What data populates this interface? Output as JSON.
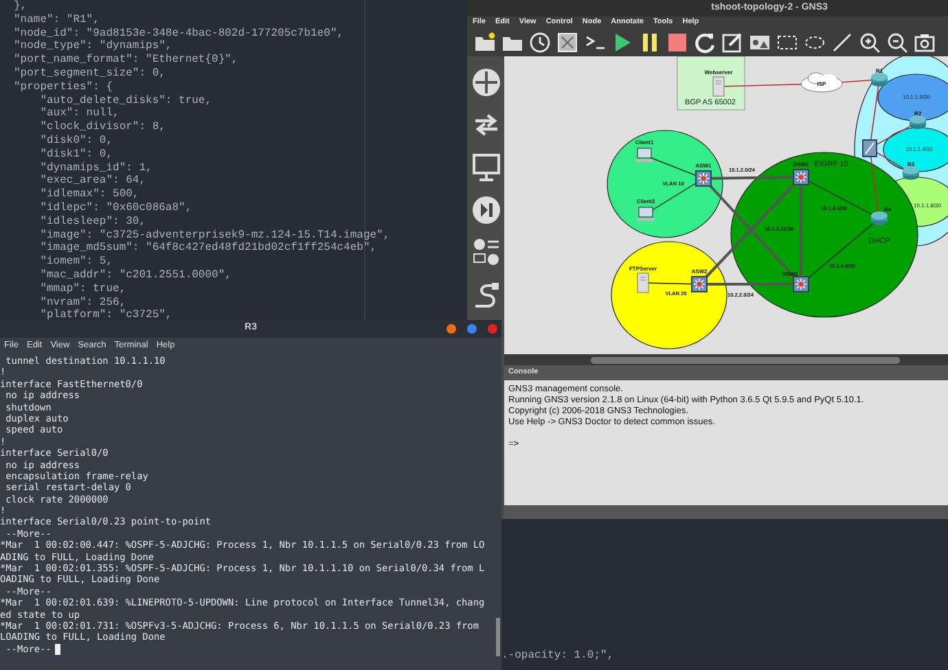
{
  "editor": {
    "lines": [
      "},",
      "\"name\": \"R1\",",
      "\"node_id\": \"9ad8153e-348e-4bac-802d-177205c7b1e0\",",
      "\"node_type\": \"dynamips\",",
      "\"port_name_format\": \"Ethernet{0}\",",
      "\"port_segment_size\": 0,",
      "\"properties\": {",
      "    \"auto_delete_disks\": true,",
      "    \"aux\": null,",
      "    \"clock_divisor\": 8,",
      "    \"disk0\": 0,",
      "    \"disk1\": 0,",
      "    \"dynamips_id\": 1,",
      "    \"exec_area\": 64,",
      "    \"idlemax\": 500,",
      "    \"idlepc\": \"0x60c086a8\",",
      "    \"idlesleep\": 30,",
      "    \"image\": \"c3725-adventerprisek9-mz.124-15.T14.image\",",
      "    \"image_md5sum\": \"64f8c427ed48fd21bd02cf1ff254c4eb\",",
      "    \"iomem\": 5,",
      "    \"mac_addr\": \"c201.2551.0000\",",
      "    \"mmap\": true,",
      "    \"nvram\": 256,",
      "    \"platform\": \"c3725\","
    ],
    "lower_lines": [
      ".-opacity: 1.0;\","
    ]
  },
  "gns3": {
    "title": "tshoot-topology-2 - GNS3",
    "menu": [
      "File",
      "Edit",
      "View",
      "Control",
      "Node",
      "Annotate",
      "Tools",
      "Help"
    ],
    "topology": {
      "areas": [
        {
          "kind": "box",
          "label": "BGP AS 65002",
          "color": "#ccf5cc"
        },
        {
          "kind": "ellipse",
          "label": "DHCP",
          "color": "#aaf4ff"
        },
        {
          "kind": "ellipse",
          "label": "10.1.1.0/30",
          "color": "#4fa0f0"
        },
        {
          "kind": "ellipse",
          "label": "10.1.1.4/30",
          "color": "#00f0f0"
        },
        {
          "kind": "ellipse",
          "label": "10.1.1.8/30",
          "color": "#aaff77"
        },
        {
          "kind": "ellipse",
          "label": "EIGRP 10",
          "color": "#00a000"
        },
        {
          "kind": "ellipse",
          "color": "#33ee88"
        },
        {
          "kind": "ellipse",
          "color": "#ffff00"
        }
      ],
      "nodes": [
        {
          "kind": "server",
          "label": "Webserver"
        },
        {
          "kind": "cloud",
          "label": "ISP"
        },
        {
          "kind": "router",
          "label": "R1"
        },
        {
          "kind": "router",
          "label": "R2"
        },
        {
          "kind": "frswitch"
        },
        {
          "kind": "router",
          "label": "R3"
        },
        {
          "kind": "router",
          "label": "R4"
        },
        {
          "kind": "laptop",
          "label": "Client1"
        },
        {
          "kind": "laptop",
          "label": "Client2"
        },
        {
          "kind": "switch",
          "label": "ASW1"
        },
        {
          "kind": "switch",
          "label": "DSW1"
        },
        {
          "kind": "switch",
          "label": "DSW2"
        },
        {
          "kind": "server",
          "label": "FTPServer"
        },
        {
          "kind": "switch",
          "label": "ASW2"
        }
      ],
      "link_labels": [
        "VLAN 10",
        "10.1.2.0/24",
        "10.1.4.4/30",
        "10.2.4.12/30",
        "10.1.4.8/30",
        "VLAN 20",
        "10.2.2.0/24"
      ]
    },
    "console": {
      "title": "Console",
      "lines": [
        "GNS3 management console.",
        "Running GNS3 version 2.1.8 on Linux (64-bit) with Python 3.6.5 Qt 5.9.5 and PyQt 5.10.1.",
        "Copyright (c) 2006-2018 GNS3 Technologies.",
        "Use Help -> GNS3 Doctor to detect common issues."
      ],
      "prompt": "=>"
    }
  },
  "terminal": {
    "title": "R3",
    "menu": [
      "File",
      "Edit",
      "View",
      "Search",
      "Terminal",
      "Help"
    ],
    "lines": [
      " tunnel destination 10.1.1.10",
      "!",
      "interface FastEthernet0/0",
      " no ip address",
      " shutdown",
      " duplex auto",
      " speed auto",
      "!",
      "interface Serial0/0",
      " no ip address",
      " encapsulation frame-relay",
      " serial restart-delay 0",
      " clock rate 2000000",
      "!",
      "interface Serial0/0.23 point-to-point",
      " --More--",
      "*Mar  1 00:02:00.447: %OSPF-5-ADJCHG: Process 1, Nbr 10.1.1.5 on Serial0/0.23 from LO",
      "ADING to FULL, Loading Done",
      "*Mar  1 00:02:01.355: %OSPF-5-ADJCHG: Process 1, Nbr 10.1.1.10 on Serial0/0.34 from L",
      "OADING to FULL, Loading Done",
      " --More--",
      "*Mar  1 00:02:01.639: %LINEPROTO-5-UPDOWN: Line protocol on Interface Tunnel34, chang",
      "ed state to up",
      "*Mar  1 00:02:01.731: %OSPFv3-5-ADJCHG: Process 6, Nbr 10.1.1.5 on Serial0/0.23 from",
      "LOADING to FULL, Loading Done",
      " --More--"
    ]
  }
}
